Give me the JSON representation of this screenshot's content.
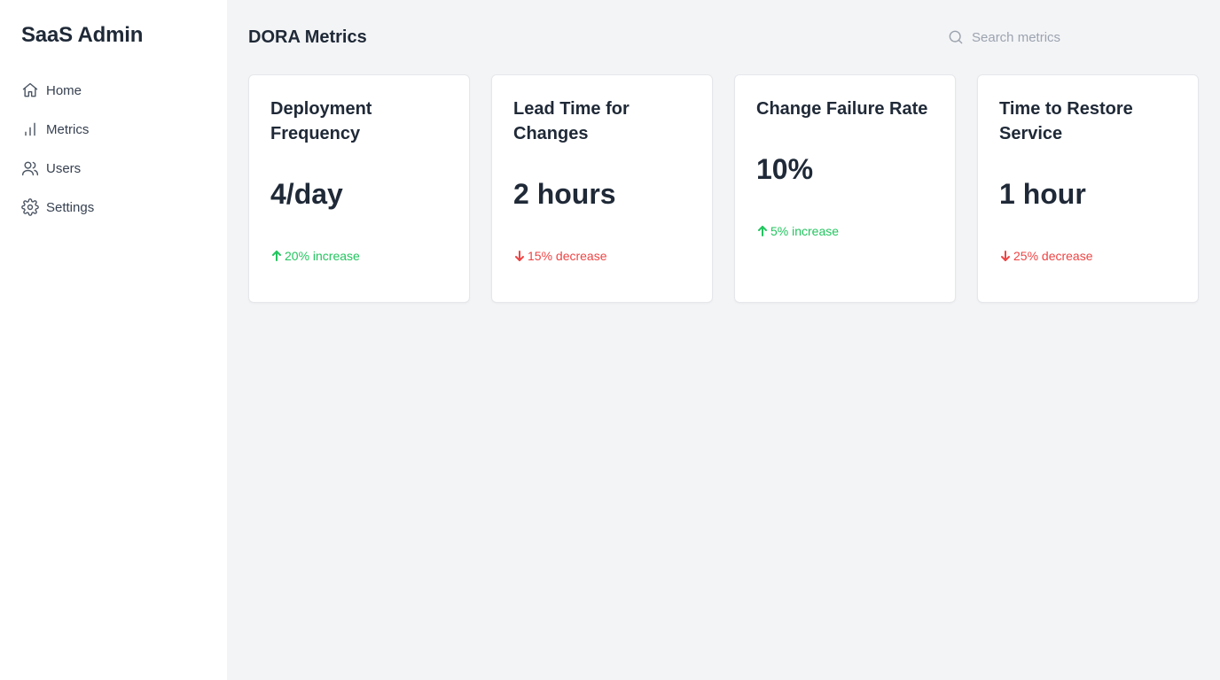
{
  "sidebar": {
    "brand": "SaaS Admin",
    "items": [
      {
        "label": "Home",
        "icon": "home-icon"
      },
      {
        "label": "Metrics",
        "icon": "bar-chart-icon"
      },
      {
        "label": "Users",
        "icon": "users-icon"
      },
      {
        "label": "Settings",
        "icon": "gear-icon"
      }
    ]
  },
  "header": {
    "title": "DORA Metrics",
    "search_placeholder": "Search metrics",
    "search_value": ""
  },
  "colors": {
    "increase": "#22c55e",
    "decrease": "#ef4444",
    "background": "#f3f4f6",
    "card": "#ffffff"
  },
  "cards": [
    {
      "title": "Deployment Frequency",
      "value": "4/day",
      "change": "20% increase",
      "direction": "up"
    },
    {
      "title": "Lead Time for Changes",
      "value": "2 hours",
      "change": "15% decrease",
      "direction": "down"
    },
    {
      "title": "Change Failure Rate",
      "value": "10%",
      "change": "5% increase",
      "direction": "up"
    },
    {
      "title": "Time to Restore Service",
      "value": "1 hour",
      "change": "25% decrease",
      "direction": "down"
    }
  ]
}
